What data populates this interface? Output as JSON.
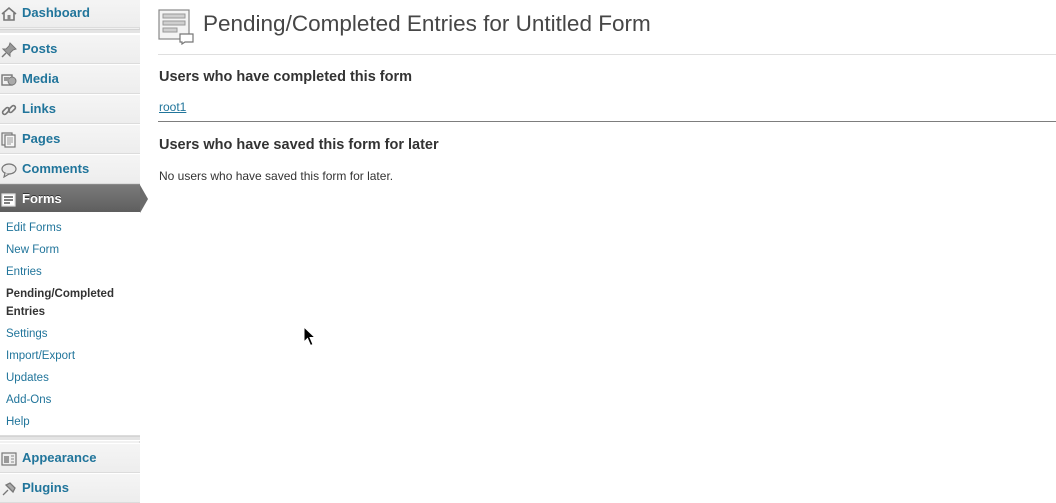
{
  "sidebar": {
    "menu_items": {
      "dashboard": "Dashboard",
      "posts": "Posts",
      "media": "Media",
      "links": "Links",
      "pages": "Pages",
      "comments": "Comments",
      "forms": "Forms",
      "appearance": "Appearance",
      "plugins": "Plugins"
    },
    "forms_submenu": {
      "edit_forms": "Edit Forms",
      "new_form": "New Form",
      "entries": "Entries",
      "pending_completed": "Pending/Completed Entries",
      "settings": "Settings",
      "import_export": "Import/Export",
      "updates": "Updates",
      "add_ons": "Add-Ons",
      "help": "Help"
    },
    "icons": [
      "dashboard-icon",
      "pin-icon",
      "media-icon",
      "link-icon",
      "pages-icon",
      "comment-icon",
      "forms-icon",
      "appearance-icon",
      "plugins-icon"
    ]
  },
  "main": {
    "title": "Pending/Completed Entries for Untitled Form",
    "completed_heading": "Users who have completed this form",
    "completed_users": [
      "root1"
    ],
    "saved_heading": "Users who have saved this form for later",
    "saved_empty_message": "No users who have saved this form for later."
  },
  "colors": {
    "link": "#21759b",
    "sidebar_bg": "#f1f1f1",
    "current_menu_bg": "#6b6b6b",
    "text": "#333333"
  }
}
